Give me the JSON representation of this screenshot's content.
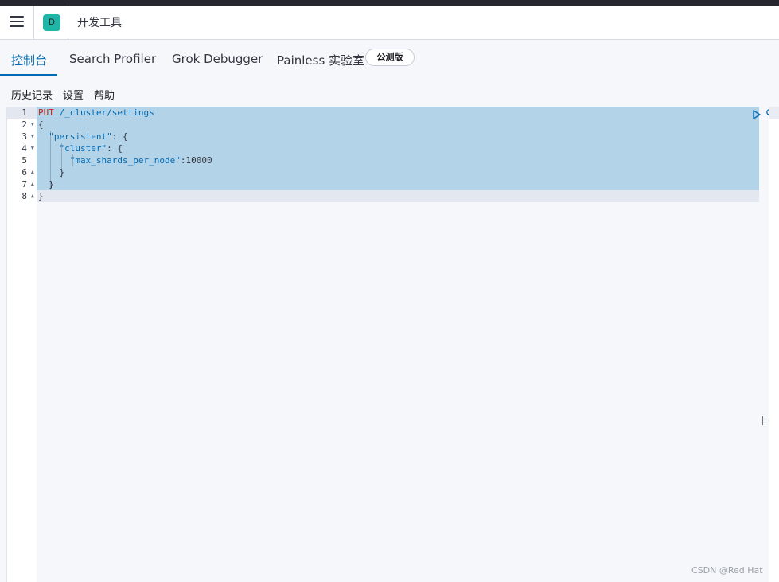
{
  "header": {
    "space_initial": "D",
    "app_title": "开发工具"
  },
  "tabs": [
    {
      "label": "控制台",
      "active": true
    },
    {
      "label": "Search Profiler",
      "active": false
    },
    {
      "label": "Grok Debugger",
      "active": false
    },
    {
      "label": "Painless 实验室",
      "active": false
    }
  ],
  "beta_badge": "公测版",
  "toolbar": {
    "history": "历史记录",
    "settings": "设置",
    "help": "帮助"
  },
  "editor": {
    "line_numbers": [
      "1",
      "2",
      "3",
      "4",
      "5",
      "6",
      "7",
      "8"
    ],
    "code": {
      "method": "PUT",
      "url": " /_cluster/settings",
      "brace_open": "{",
      "persistent_key": "\"persistent\"",
      "cluster_key": "\"cluster\"",
      "colon_brace": ": {",
      "max_shards_key": "\"max_shards_per_node\"",
      "max_shards_colon": ":",
      "max_shards_value": "10000",
      "brace_close": "}"
    }
  },
  "watermark": "CSDN @Red Hat",
  "colors": {
    "accent": "#006bb4",
    "selection": "#b3d3e8",
    "avatar": "#20b5a6",
    "method": "#bd271e"
  },
  "icons": {
    "menu": "hamburger-icon",
    "run": "play-icon",
    "wrench": "wrench-icon"
  }
}
